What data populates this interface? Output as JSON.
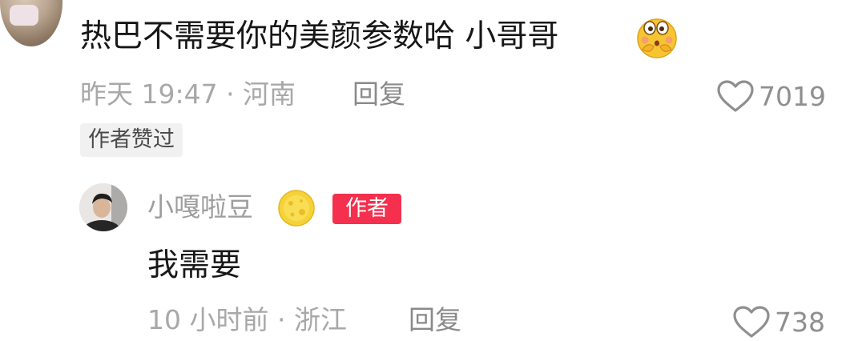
{
  "comment": {
    "text": "热巴不需要你的美颜参数哈 小哥哥",
    "emoji": "shy-face-emoji",
    "time_location": "昨天 19:47 · 河南",
    "reply_label": "回复",
    "like_count": "7019",
    "author_liked_badge": "作者赞过"
  },
  "reply": {
    "username": "小嘎啦豆",
    "author_badge": "作者",
    "text": "我需要",
    "time_location": "10 小时前 · 浙江",
    "reply_label": "回复",
    "like_count": "738"
  },
  "colors": {
    "author_badge_bg": "#f5304f",
    "meta_text": "#a8a8a8",
    "username_text": "#9e9e9e"
  }
}
